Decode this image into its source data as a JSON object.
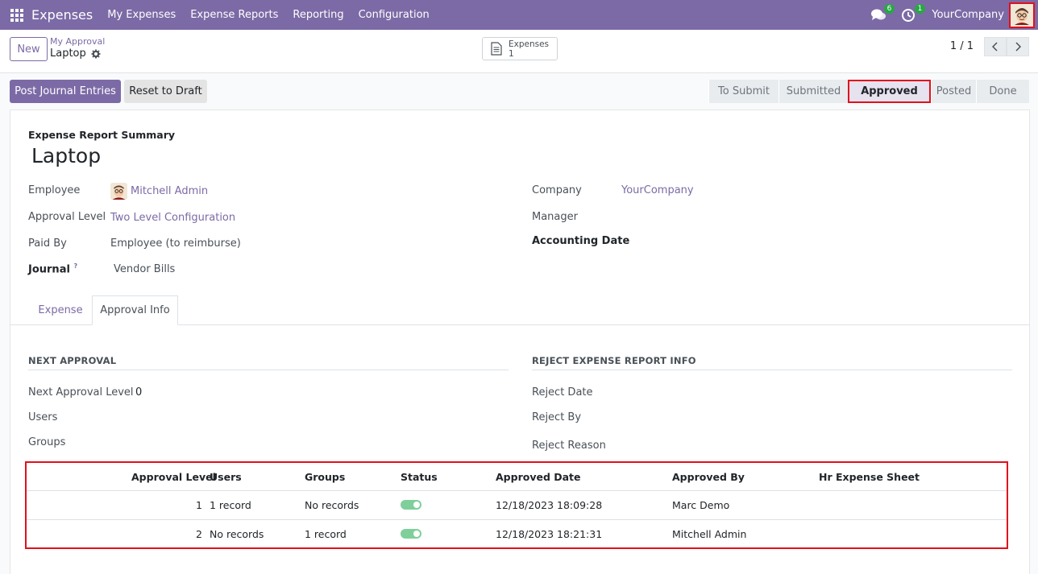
{
  "navbar": {
    "app_name": "Expenses",
    "menu": [
      "My Expenses",
      "Expense Reports",
      "Reporting",
      "Configuration"
    ],
    "messages_count": "6",
    "activities_count": "1",
    "company": "YourCompany",
    "colors": {
      "brand": "#7c6aa6",
      "badge": "#28a745",
      "highlight": "#e0101c"
    }
  },
  "control": {
    "new_label": "New",
    "breadcrumb_parent": "My Approval",
    "breadcrumb_current": "Laptop",
    "smart_button": {
      "label": "Expenses",
      "count": "1"
    },
    "pager": "1 / 1"
  },
  "actions": {
    "post": "Post Journal Entries",
    "reset": "Reset to Draft"
  },
  "statusbar": {
    "stages": [
      "To Submit",
      "Submitted",
      "Approved",
      "Posted",
      "Done"
    ],
    "current": "Approved"
  },
  "form": {
    "summary_label": "Expense Report Summary",
    "title": "Laptop",
    "left_fields": [
      {
        "label": "Employee",
        "value": "Mitchell Admin"
      },
      {
        "label": "Approval Level",
        "value": "Two Level Configuration"
      },
      {
        "label": "Paid By",
        "value": "Employee (to reimburse)"
      },
      {
        "label": "Journal",
        "help": "?",
        "value": "Vendor Bills"
      }
    ],
    "right_fields": [
      {
        "label": "Company",
        "value": "YourCompany"
      },
      {
        "label": "Manager",
        "value": ""
      },
      {
        "label": "Accounting Date",
        "value": ""
      }
    ]
  },
  "tabs": [
    "Expense",
    "Approval Info"
  ],
  "approval_info": {
    "next_approval_title": "NEXT APPROVAL",
    "next_approval_level_label": "Next Approval Level",
    "next_approval_level_value": "0",
    "users_label": "Users",
    "groups_label": "Groups",
    "reject_title": "REJECT EXPENSE REPORT INFO",
    "reject_date_label": "Reject Date",
    "reject_by_label": "Reject By",
    "reject_reason_label": "Reject Reason"
  },
  "approval_table": {
    "headers": [
      "Approval Level",
      "Users",
      "Groups",
      "Status",
      "Approved Date",
      "Approved By",
      "Hr Expense Sheet"
    ],
    "rows": [
      {
        "level": "1",
        "users": "1 record",
        "groups": "No records",
        "status": true,
        "approved_date": "12/18/2023 18:09:28",
        "approved_by": "Marc Demo",
        "sheet": ""
      },
      {
        "level": "2",
        "users": "No records",
        "groups": "1 record",
        "status": true,
        "approved_date": "12/18/2023 18:21:31",
        "approved_by": "Mitchell Admin",
        "sheet": ""
      }
    ]
  }
}
